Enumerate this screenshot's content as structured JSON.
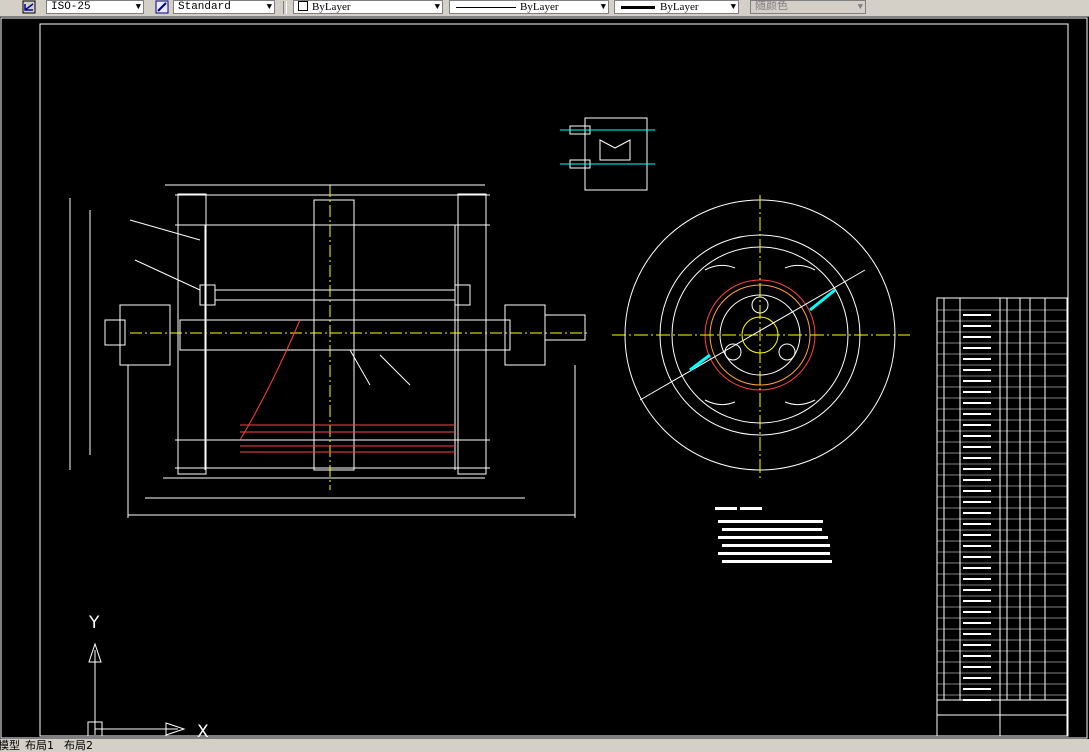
{
  "toolbar": {
    "dimstyle": "ISO-25",
    "tablestyle": "Standard",
    "layer": "ByLayer",
    "linetype": "ByLayer",
    "lineweight": "ByLayer",
    "color": "随颜色"
  },
  "ucs": {
    "x_label": "X",
    "y_label": "Y"
  },
  "tabs": {
    "model": "模型",
    "layout1": "布局1",
    "layout2": "布局2"
  },
  "colors": {
    "background": "#000000",
    "drawing": "#ffffff",
    "centerline": "#ffff00",
    "section": "#ff4040",
    "highlight": "#00ffff"
  }
}
